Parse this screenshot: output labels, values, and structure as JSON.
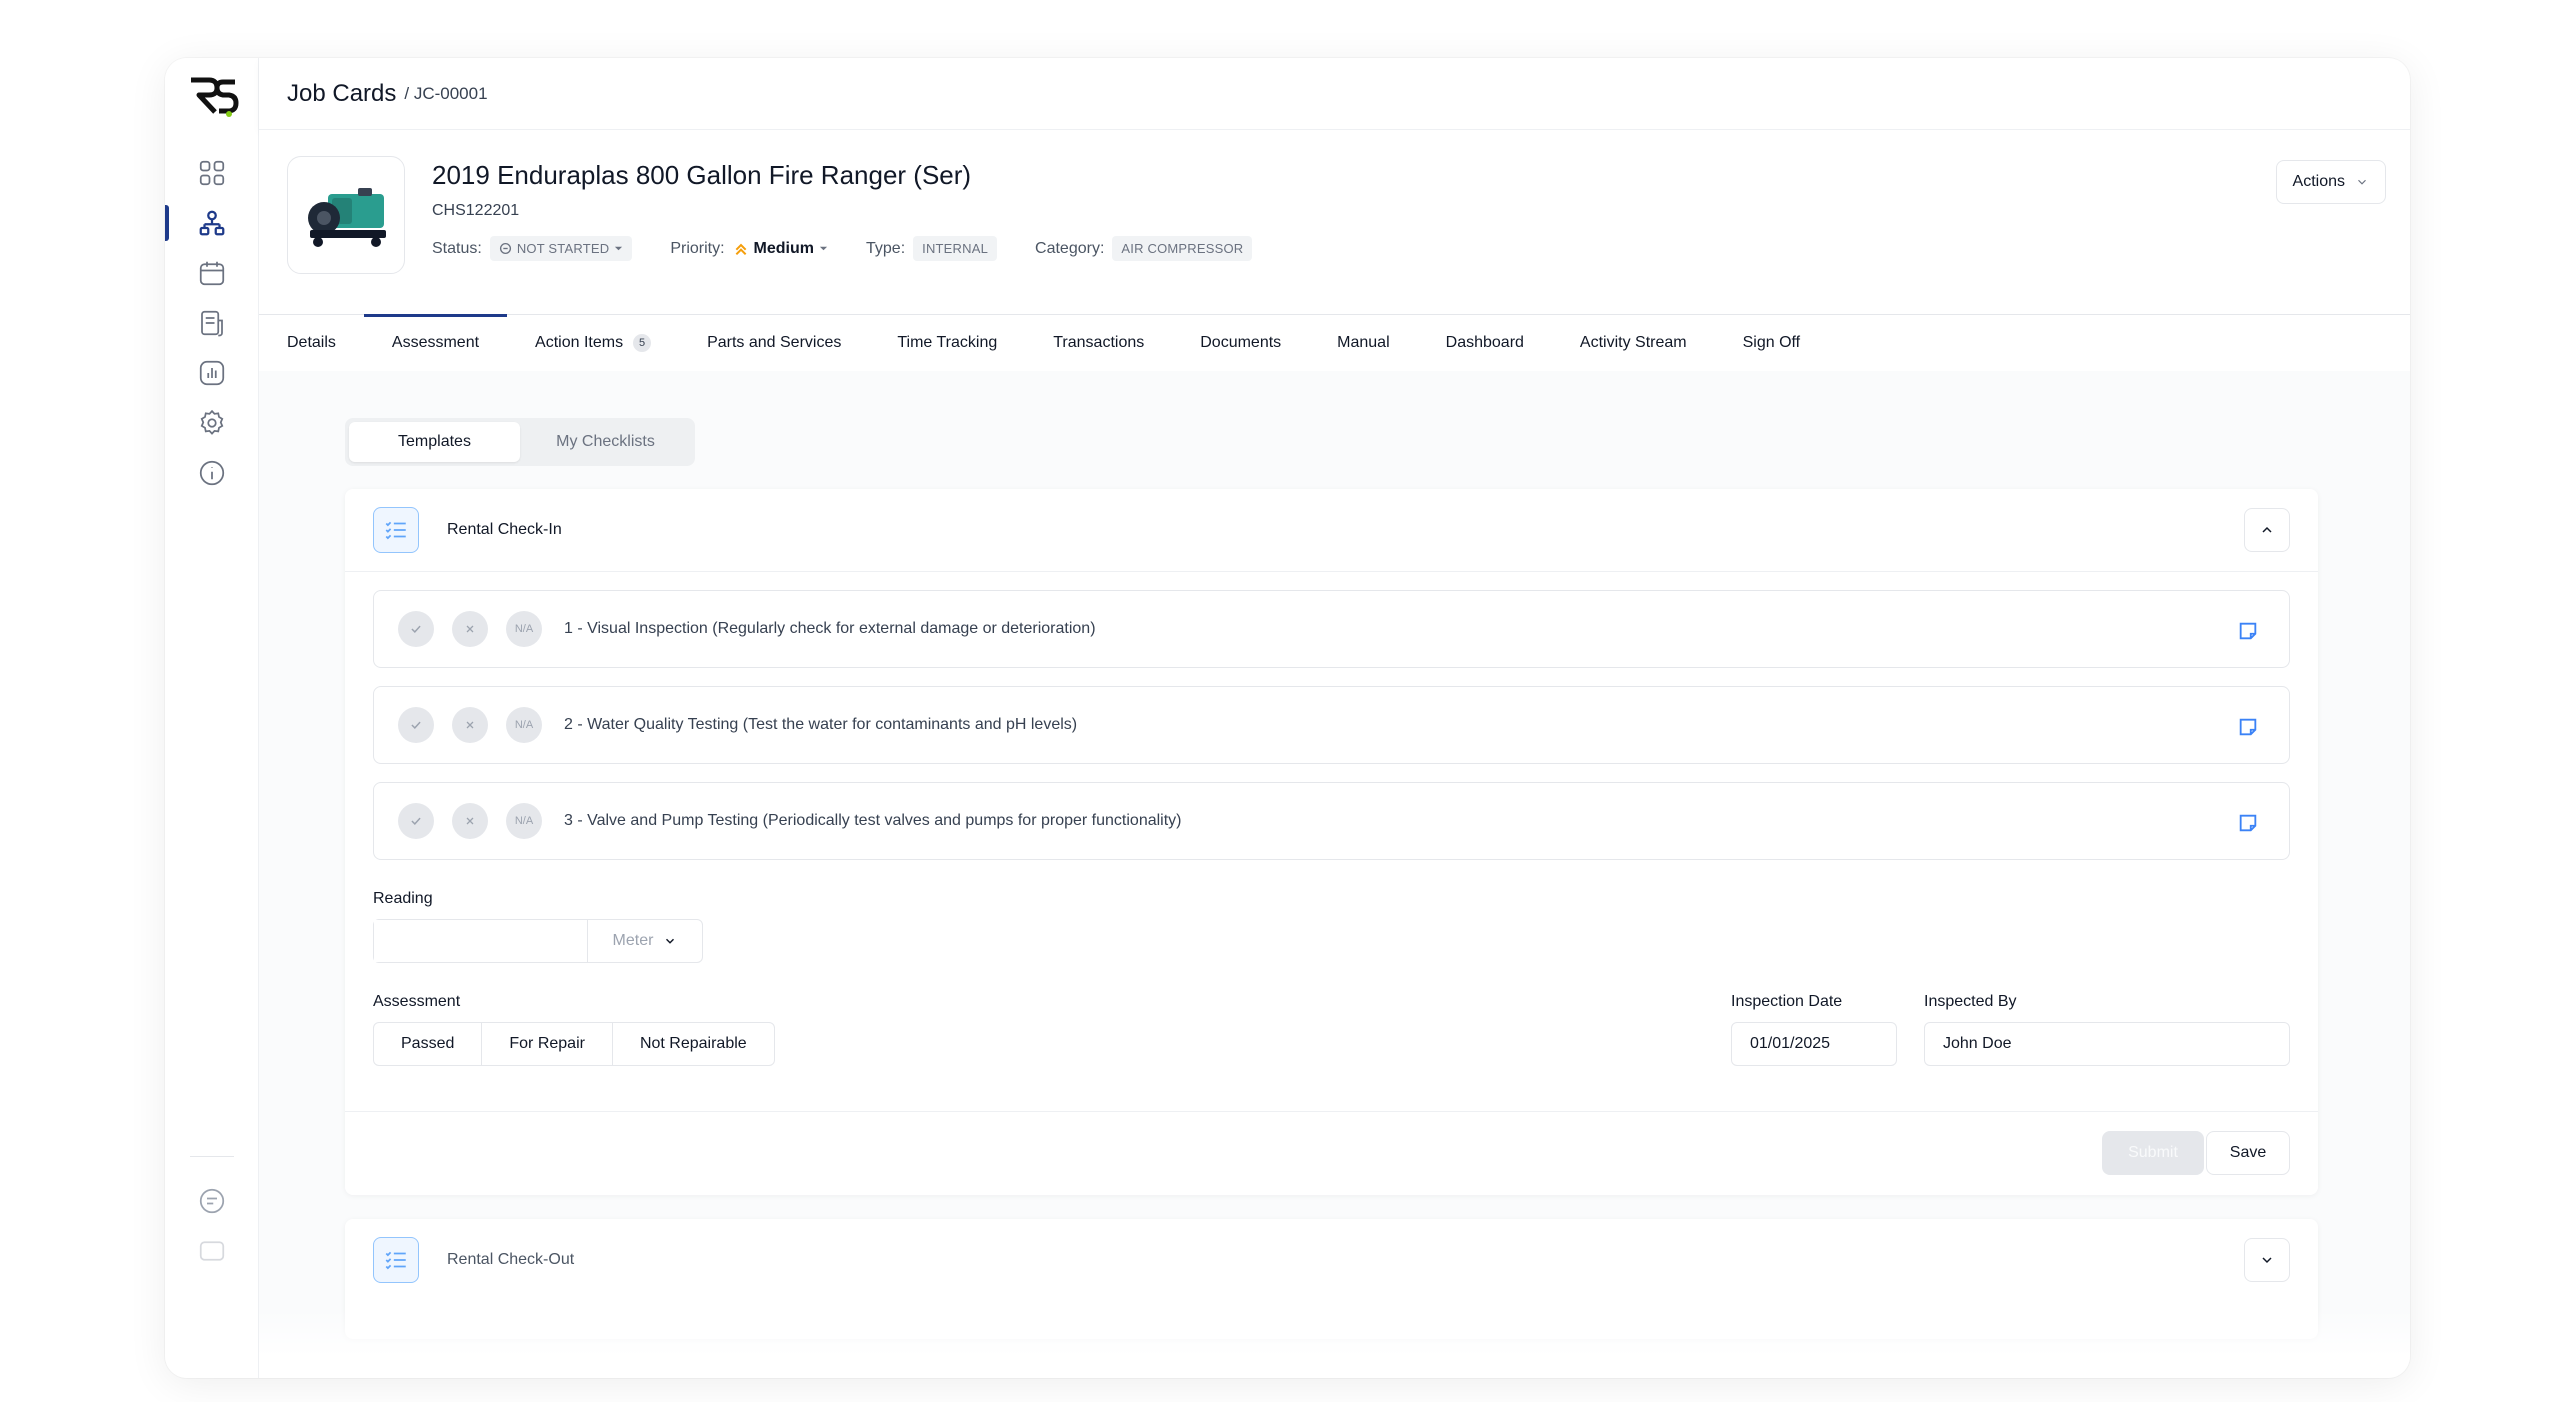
{
  "breadcrumb": {
    "section": "Job Cards",
    "current": "/ JC-00001"
  },
  "asset": {
    "title": "2019 Enduraplas 800 Gallon Fire Ranger (Ser)",
    "serial": "CHS122201",
    "status_label": "Status:",
    "status_value": "NOT STARTED",
    "priority_label": "Priority:",
    "priority_value": "Medium",
    "type_label": "Type:",
    "type_value": "INTERNAL",
    "category_label": "Category:",
    "category_value": "AIR COMPRESSOR",
    "actions_label": "Actions"
  },
  "tabs": [
    {
      "label": "Details"
    },
    {
      "label": "Assessment",
      "active": true
    },
    {
      "label": "Action Items",
      "badge": "5"
    },
    {
      "label": "Parts and Services"
    },
    {
      "label": "Time Tracking"
    },
    {
      "label": "Transactions"
    },
    {
      "label": "Documents"
    },
    {
      "label": "Manual"
    },
    {
      "label": "Dashboard"
    },
    {
      "label": "Activity Stream"
    },
    {
      "label": "Sign Off"
    }
  ],
  "segment": {
    "templates": "Templates",
    "my_checklists": "My Checklists"
  },
  "checklist": {
    "title": "Rental Check-In",
    "na_label": "N/A",
    "items": [
      {
        "text": "1 - Visual Inspection (Regularly check for external damage or deterioration)"
      },
      {
        "text": "2 - Water Quality Testing (Test the water for contaminants and pH levels)"
      },
      {
        "text": "3 - Valve and Pump Testing (Periodically test valves and pumps for proper functionality)"
      }
    ],
    "reading_label": "Reading",
    "reading_value": "",
    "reading_unit": "Meter",
    "assessment_label": "Assessment",
    "assessment_options": [
      "Passed",
      "For Repair",
      "Not Repairable"
    ],
    "inspection_date_label": "Inspection Date",
    "inspection_date_value": "01/01/2025",
    "inspected_by_label": "Inspected By",
    "inspected_by_value": "John Doe",
    "submit_label": "Submit",
    "save_label": "Save"
  },
  "checklist2": {
    "title": "Rental Check-Out"
  },
  "colors": {
    "accent": "#1e3a8a",
    "priority": "#f59e0b",
    "checklist_icon": "#60a5fa"
  }
}
